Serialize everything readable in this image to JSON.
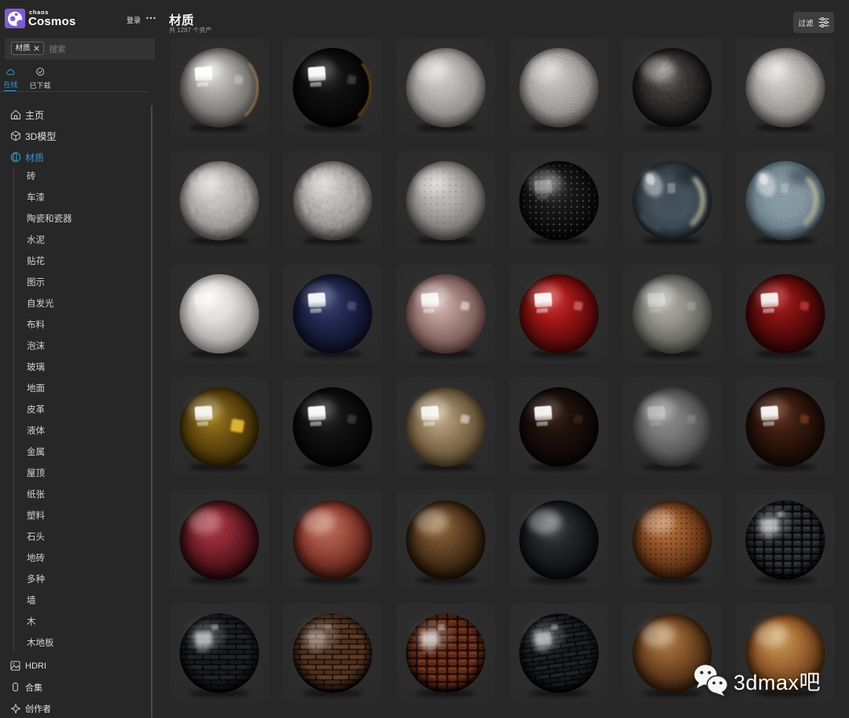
{
  "app": {
    "brand_small": "chaos",
    "brand_large": "Cosmos",
    "login_label": "登录"
  },
  "search": {
    "chip": "材质",
    "placeholder": "搜索"
  },
  "tabs": [
    {
      "id": "online",
      "label": "在线",
      "icon": "cloud-icon",
      "active": true
    },
    {
      "id": "downloaded",
      "label": "已下载",
      "icon": "check-circle-icon",
      "active": false
    }
  ],
  "nav": [
    {
      "id": "home",
      "label": "主页",
      "icon": "home-icon",
      "active": false
    },
    {
      "id": "3d-models",
      "label": "3D模型",
      "icon": "cube-icon",
      "active": false
    },
    {
      "id": "materials",
      "label": "材质",
      "icon": "sphere-icon",
      "active": true
    }
  ],
  "nav_sub": [
    "砖",
    "车漆",
    "陶瓷和瓷器",
    "水泥",
    "贴花",
    "图示",
    "自发光",
    "布料",
    "泡沫",
    "玻璃",
    "地面",
    "皮革",
    "液体",
    "金属",
    "屋顶",
    "纸张",
    "塑料",
    "石头",
    "地砖",
    "多种",
    "墙",
    "木",
    "木地板"
  ],
  "nav_bottom": [
    {
      "id": "hdri",
      "label": "HDRI",
      "icon": "image-icon"
    },
    {
      "id": "collections",
      "label": "合集",
      "icon": "collection-icon"
    },
    {
      "id": "creators",
      "label": "创作者",
      "icon": "sparkle-icon"
    }
  ],
  "header": {
    "title": "材质",
    "subtitle": "共 1287 个资产",
    "filter_label": "过滤",
    "filter_icon": "sliders-icon"
  },
  "watermark": {
    "text": "3dmax吧",
    "icon": "wechat-icon"
  },
  "colors": {
    "accent": "#2f9bd8",
    "brand_purple": "#7d5cd3",
    "page_bg": "#272727",
    "tile_bg": "#2d2d2d",
    "search_bg": "#343434",
    "button_bg": "#3e3e3e"
  },
  "spheres": [
    {
      "n": "polished-ceramic-white",
      "hi": "#e9e8e5",
      "base": "#aca9a6",
      "lo": "#757370",
      "eg": "#55534e",
      "w": 0.95,
      "w2": 0.28,
      "w2c": "#ffffff",
      "sh": 0.22,
      "rim": "#c89552",
      "ro": 0.65,
      "dk": 0.38
    },
    {
      "n": "polished-black",
      "hi": "#3e3e3e",
      "base": "#111111",
      "lo": "#070707",
      "eg": "#000000",
      "w": 0.97,
      "w2": 0.18,
      "w2c": "#ffffff",
      "sh": 0.12,
      "rim": "#bd8440",
      "ro": 0.7,
      "dk": 0.25
    },
    {
      "n": "matte-gray-plaster",
      "hi": "#d6d4d1",
      "base": "#aeacaa",
      "lo": "#7d7b78",
      "eg": "#5c5a56",
      "w": 0,
      "sh": 0.28,
      "dk": 0.38,
      "tx": {
        "t": "nz",
        "f": "fn",
        "o": 0.3
      }
    },
    {
      "n": "speckled-concrete",
      "hi": "#cac8c5",
      "base": "#9f9d9a",
      "lo": "#716f6c",
      "eg": "#514f4c",
      "w": 0,
      "sh": 0.22,
      "dk": 0.4,
      "tx": {
        "t": "nz",
        "f": "fn",
        "o": 0.5
      }
    },
    {
      "n": "rough-asphalt-black",
      "hi": "#61605c",
      "base": "#2c2b2a",
      "lo": "#161515",
      "eg": "#0a0a09",
      "w": 0,
      "sh": 0.3,
      "dk": 0.5,
      "tx": {
        "t": "nz",
        "f": "md",
        "o": 0.75
      }
    },
    {
      "n": "stucco-light-gray",
      "hi": "#dcdad6",
      "base": "#adaba7",
      "lo": "#7a7874",
      "eg": "#575551",
      "w": 0,
      "sh": 0.25,
      "dk": 0.4,
      "tx": {
        "t": "nz",
        "f": "fn",
        "o": 0.4
      }
    },
    {
      "n": "rough-plaster",
      "hi": "#d8d6d2",
      "base": "#b2b0ad",
      "lo": "#7e7c79",
      "eg": "#5b5956",
      "w": 0,
      "sh": 0.2,
      "dk": 0.42,
      "tx": {
        "t": "nz",
        "f": "lg",
        "o": 0.38
      }
    },
    {
      "n": "crumpled-plaster",
      "hi": "#d0cecb",
      "base": "#a6a4a1",
      "lo": "#706e6b",
      "eg": "#4f4d4a",
      "w": 0,
      "sh": 0.16,
      "dk": 0.45,
      "tx": {
        "t": "nz",
        "f": "lg",
        "o": 0.48
      }
    },
    {
      "n": "dimpled-acoustic-gray",
      "hi": "#d4d2cf",
      "base": "#b2b0ad",
      "lo": "#7f7d7a",
      "eg": "#5c5a56",
      "w": 0,
      "sh": 0.25,
      "dk": 0.4,
      "tx": {
        "t": "dots",
        "c": "#76746f",
        "r": 1.25,
        "s": 8,
        "o": 0.4
      }
    },
    {
      "n": "perforated-black",
      "hi": "#4c4c4c",
      "base": "#181818",
      "lo": "#0b0b0b",
      "eg": "#020202",
      "w": 0.3,
      "sh": 0.28,
      "dk": 0.38,
      "tx": {
        "t": "dots",
        "c": "#8f8f8f",
        "r": 1.1,
        "s": 7.5,
        "o": 0.5
      }
    },
    {
      "n": "clear-glass",
      "gl": 1
    },
    {
      "n": "frosted-blue-glass",
      "gl": 2
    },
    {
      "n": "porcelain-white",
      "hi": "#f5f4f2",
      "base": "#e0dfdc",
      "lo": "#aeadaa",
      "eg": "#91908d",
      "w": 0.4,
      "sh": 0.3,
      "dk": 0.28
    },
    {
      "n": "navy-blue-gloss",
      "hi": "#4c5484",
      "base": "#242b54",
      "lo": "#121631",
      "eg": "#0a0c1e",
      "w": 0.93,
      "w2": 0.3,
      "w2c": "#9aa2c8",
      "sh": 0.15,
      "dk": 0.3
    },
    {
      "n": "rose-translucent-glass",
      "hi": "#dcc2be",
      "base": "#ab8c88",
      "lo": "#7e5e5a",
      "eg": "#5e4240",
      "w": 0.85,
      "w2": 0.5,
      "w2c": "#ffffff",
      "sh": 0.3,
      "dk": 0.3,
      "fy": 0.35
    },
    {
      "n": "candy-red-gloss",
      "hi": "#d24343",
      "base": "#a31717",
      "lo": "#600a0a",
      "eg": "#3a0505",
      "w": 0.93,
      "w2": 0.5,
      "w2c": "#ef9a9a",
      "sh": 0.2,
      "dk": 0.3
    },
    {
      "n": "frosted-gray-green",
      "hi": "#b5b5a9",
      "base": "#93938c",
      "lo": "#64645e",
      "eg": "#484842",
      "w": 0.32,
      "w2": 0.18,
      "w2c": "#ffffff",
      "sh": 0.3,
      "dk": 0.3,
      "fy": 0.35
    },
    {
      "n": "dark-red-gloss",
      "hi": "#b22a2a",
      "base": "#7f1010",
      "lo": "#450707",
      "eg": "#270303",
      "w": 0.9,
      "w2": 0.55,
      "w2c": "#e05050",
      "sh": 0.15,
      "dk": 0.3
    },
    {
      "n": "amber-glass",
      "hi": "#a2841f",
      "base": "#735612",
      "lo": "#4a3607",
      "eg": "#2a1e02",
      "w": 0.9,
      "w2": 0.85,
      "w2c": "#f0c63a",
      "w2big": 1,
      "sh": 0.25,
      "dk": 0.32,
      "fy": 0.35
    },
    {
      "n": "gloss-black",
      "hi": "#3a3a3a",
      "base": "#131313",
      "lo": "#080808",
      "eg": "#010101",
      "w": 0.96,
      "w2": 0.15,
      "w2c": "#ffffff",
      "sh": 0.14,
      "dk": 0.2
    },
    {
      "n": "tan-translucent",
      "hi": "#cdb496",
      "base": "#998261",
      "lo": "#6a573a",
      "eg": "#473a24",
      "w": 0.85,
      "w2": 0.5,
      "w2c": "#ffffff",
      "sh": 0.3,
      "dk": 0.3,
      "fy": 0.35
    },
    {
      "n": "chocolate-gloss",
      "hi": "#452a20",
      "base": "#20110d",
      "lo": "#0f0806",
      "eg": "#060202",
      "w": 0.93,
      "w2": 0.25,
      "w2c": "#8a5038",
      "sh": 0.12,
      "dk": 0.25
    },
    {
      "n": "frosted-smoke-gray",
      "hi": "#909090",
      "base": "#777777",
      "lo": "#505050",
      "eg": "#383838",
      "w": 0.3,
      "w2": 0.14,
      "w2c": "#ffffff",
      "sh": 0.25,
      "dk": 0.28,
      "fy": 0.35
    },
    {
      "n": "coffee-brown-gloss",
      "hi": "#6e3c23",
      "base": "#3c1c10",
      "lo": "#1e0d06",
      "eg": "#0f0603",
      "w": 0.93,
      "w2": 0.45,
      "w2c": "#a1522c",
      "sh": 0.12,
      "dk": 0.25
    },
    {
      "n": "red-leather",
      "hi": "#8e2f38",
      "base": "#6c1f28",
      "lo": "#3a0d12",
      "eg": "#200609",
      "w": 0,
      "sh": 0.26,
      "dk": 0.5,
      "tx": {
        "t": "nz",
        "f": "fn",
        "o": 0.55
      }
    },
    {
      "n": "terracotta-clay",
      "hi": "#ba6c54",
      "base": "#96493c",
      "lo": "#5e241a",
      "eg": "#3a130b",
      "w": 0,
      "sh": 0.28,
      "dk": 0.45,
      "tx": {
        "t": "nz",
        "f": "fn",
        "o": 0.25
      }
    },
    {
      "n": "brown-leather",
      "hi": "#7e5c34",
      "base": "#593c22",
      "lo": "#301e0d",
      "eg": "#1a0f05",
      "w": 0,
      "sh": 0.3,
      "dk": 0.48,
      "tx": {
        "t": "nz",
        "f": "fn",
        "o": 0.45
      }
    },
    {
      "n": "black-leather",
      "hi": "#46484a",
      "base": "#1f2123",
      "lo": "#0e1012",
      "eg": "#060708",
      "w": 0,
      "sh": 0.35,
      "dk": 0.48,
      "tx": {
        "t": "nz",
        "f": "fn",
        "o": 0.4
      }
    },
    {
      "n": "perforated-tan-leather",
      "hi": "#bf7c42",
      "base": "#98572c",
      "lo": "#5e3014",
      "eg": "#381a07",
      "w": 0,
      "sh": 0.28,
      "dk": 0.45,
      "tx": {
        "t": "dots",
        "c": "#2e1605",
        "r": 1.0,
        "s": 6.5,
        "o": 0.7
      }
    },
    {
      "n": "black-croc-gloss",
      "pat": 1,
      "spec": 0.6,
      "dk": 0.55,
      "tx": {
        "t": "croc",
        "m": "#08090a",
        "a": "#23262a",
        "b": "#31353b",
        "w": 12,
        "h": 9
      }
    },
    {
      "n": "black-glazed-brick",
      "pat": 1,
      "spec": 0.6,
      "dk": 0.55,
      "tx": {
        "t": "brick",
        "m": "#060607",
        "a": "#202225",
        "b": "#17191c",
        "w": 21,
        "h": 13
      }
    },
    {
      "n": "brown-brick",
      "pat": 1,
      "spec": 0.3,
      "dk": 0.55,
      "tx": {
        "t": "brick",
        "m": "#1e0e06",
        "a": "#5e3c27",
        "b": "#4c2f1e",
        "w": 21,
        "h": 13
      }
    },
    {
      "n": "croc-leather-redbrown",
      "pat": 1,
      "spec": 0.65,
      "dk": 0.5,
      "tx": {
        "t": "croc",
        "m": "#260c05",
        "a": "#5c2917",
        "b": "#74341d",
        "w": 13,
        "h": 10
      }
    },
    {
      "n": "black-glazed-brick-2",
      "pat": 1,
      "spec": 0.6,
      "dk": 0.55,
      "tx": {
        "t": "brick",
        "m": "#060607",
        "a": "#1f2124",
        "b": "#16181b",
        "w": 19,
        "h": 12,
        "rot": -8
      }
    },
    {
      "n": "smooth-caramel-leather",
      "hi": "#ad7e49",
      "base": "#81542a",
      "lo": "#4c2c13",
      "eg": "#2c1808",
      "w": 0,
      "sh": 0.32,
      "dk": 0.42,
      "tx": {
        "t": "nz",
        "f": "fn",
        "o": 0.18
      }
    },
    {
      "n": "grained-tan-leather",
      "hi": "#c28c52",
      "base": "#986231",
      "lo": "#5e3817",
      "eg": "#392008",
      "w": 0,
      "sh": 0.28,
      "dk": 0.45,
      "tx": {
        "t": "nz",
        "f": "fn",
        "o": 0.4
      }
    }
  ]
}
